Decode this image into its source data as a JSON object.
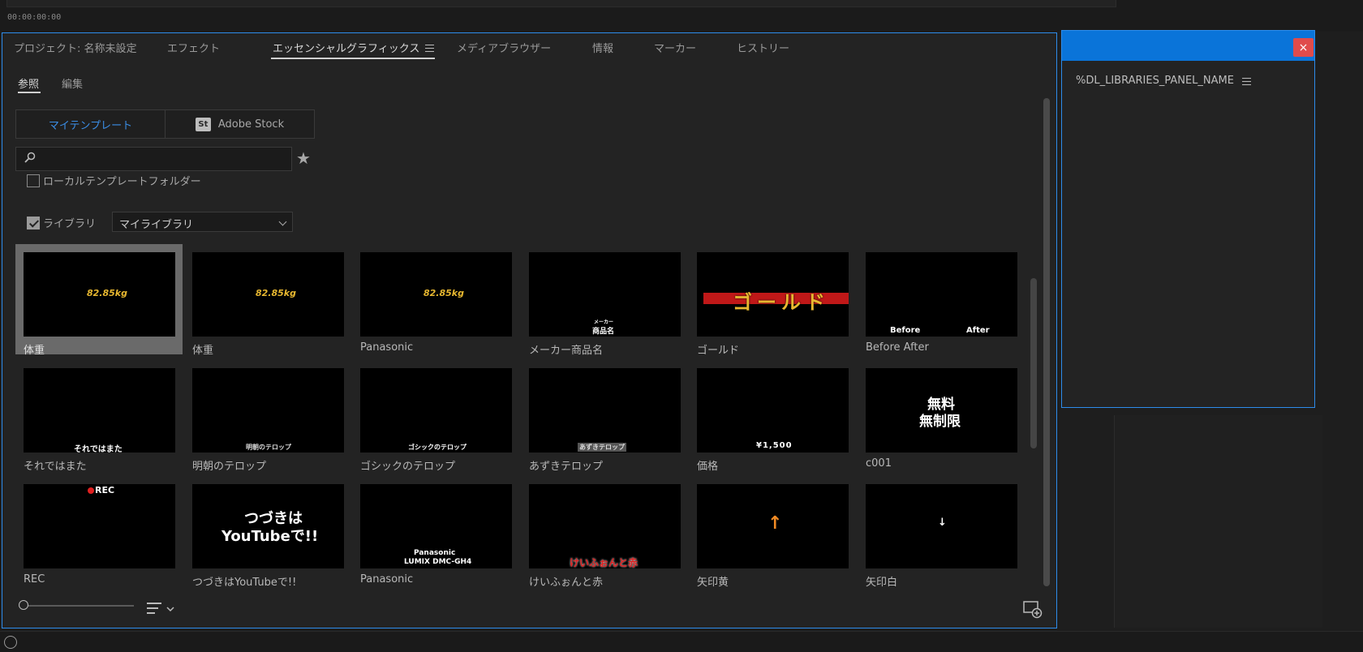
{
  "timeline": {
    "timecode": "00:00:00:00"
  },
  "tabs": [
    {
      "label": "プロジェクト: 名称未設定"
    },
    {
      "label": "エフェクト"
    },
    {
      "label": "エッセンシャルグラフィックス"
    },
    {
      "label": "メディアブラウザー"
    },
    {
      "label": "情報"
    },
    {
      "label": "マーカー"
    },
    {
      "label": "ヒストリー"
    }
  ],
  "subtabs": [
    {
      "label": "参照"
    },
    {
      "label": "編集"
    }
  ],
  "source_toggle": {
    "my_templates": "マイテンプレート",
    "adobe_stock_badge": "St",
    "adobe_stock": "Adobe Stock"
  },
  "search": {
    "placeholder": ""
  },
  "local_folder": {
    "label": "ローカルテンプレートフォルダー",
    "checked": false
  },
  "library": {
    "label": "ライブラリ",
    "checked": true,
    "selected": "マイライブラリ"
  },
  "templates": [
    {
      "label": "体重",
      "overlay": "82.85kg",
      "selected": true
    },
    {
      "label": "体重",
      "overlay": "82.85kg"
    },
    {
      "label": "Panasonic",
      "overlay": "82.85kg"
    },
    {
      "label": "メーカー商品名",
      "overlay_top": "メーカー",
      "overlay_bottom": "商品名"
    },
    {
      "label": "ゴールド",
      "overlay": "ゴールド"
    },
    {
      "label": "Before After",
      "overlay_left": "Before",
      "overlay_right": "After"
    },
    {
      "label": "それではまた",
      "overlay": "それではまた"
    },
    {
      "label": "明朝のテロップ",
      "overlay": "明朝のテロップ"
    },
    {
      "label": "ゴシックのテロップ",
      "overlay": "ゴシックのテロップ"
    },
    {
      "label": "あずきテロップ",
      "overlay": "あずきテロップ"
    },
    {
      "label": "価格",
      "overlay": "¥1,500"
    },
    {
      "label": "c001",
      "overlay_top": "無料",
      "overlay_bottom": "無制限"
    },
    {
      "label": "REC",
      "overlay": "REC"
    },
    {
      "label": "つづきはYouTubeで!!",
      "overlay_top": "つづきは",
      "overlay_bottom": "YouTubeで!!"
    },
    {
      "label": "Panasonic",
      "overlay_top": "Panasonic",
      "overlay_bottom": "LUMIX DMC-GH4"
    },
    {
      "label": "けいふぉんと赤",
      "overlay": "けいふぉんと赤"
    },
    {
      "label": "矢印黄",
      "overlay": "↑"
    },
    {
      "label": "矢印白",
      "overlay": "↓"
    }
  ],
  "libraries_panel": {
    "title": "%DL_LIBRARIES_PANEL_NAME",
    "close": "×"
  },
  "colors": {
    "accent": "#2d8ceb",
    "header_blue": "#0a74d9",
    "close_red": "#e04b4b",
    "gold": "#e8b830",
    "red": "#e02020",
    "orange": "#f08a24"
  },
  "icons": [
    "search-icon",
    "star-icon",
    "chevron-down-icon",
    "list-view-icon",
    "new-item-icon",
    "hamburger-menu-icon",
    "close-icon",
    "creative-cloud-icon"
  ]
}
